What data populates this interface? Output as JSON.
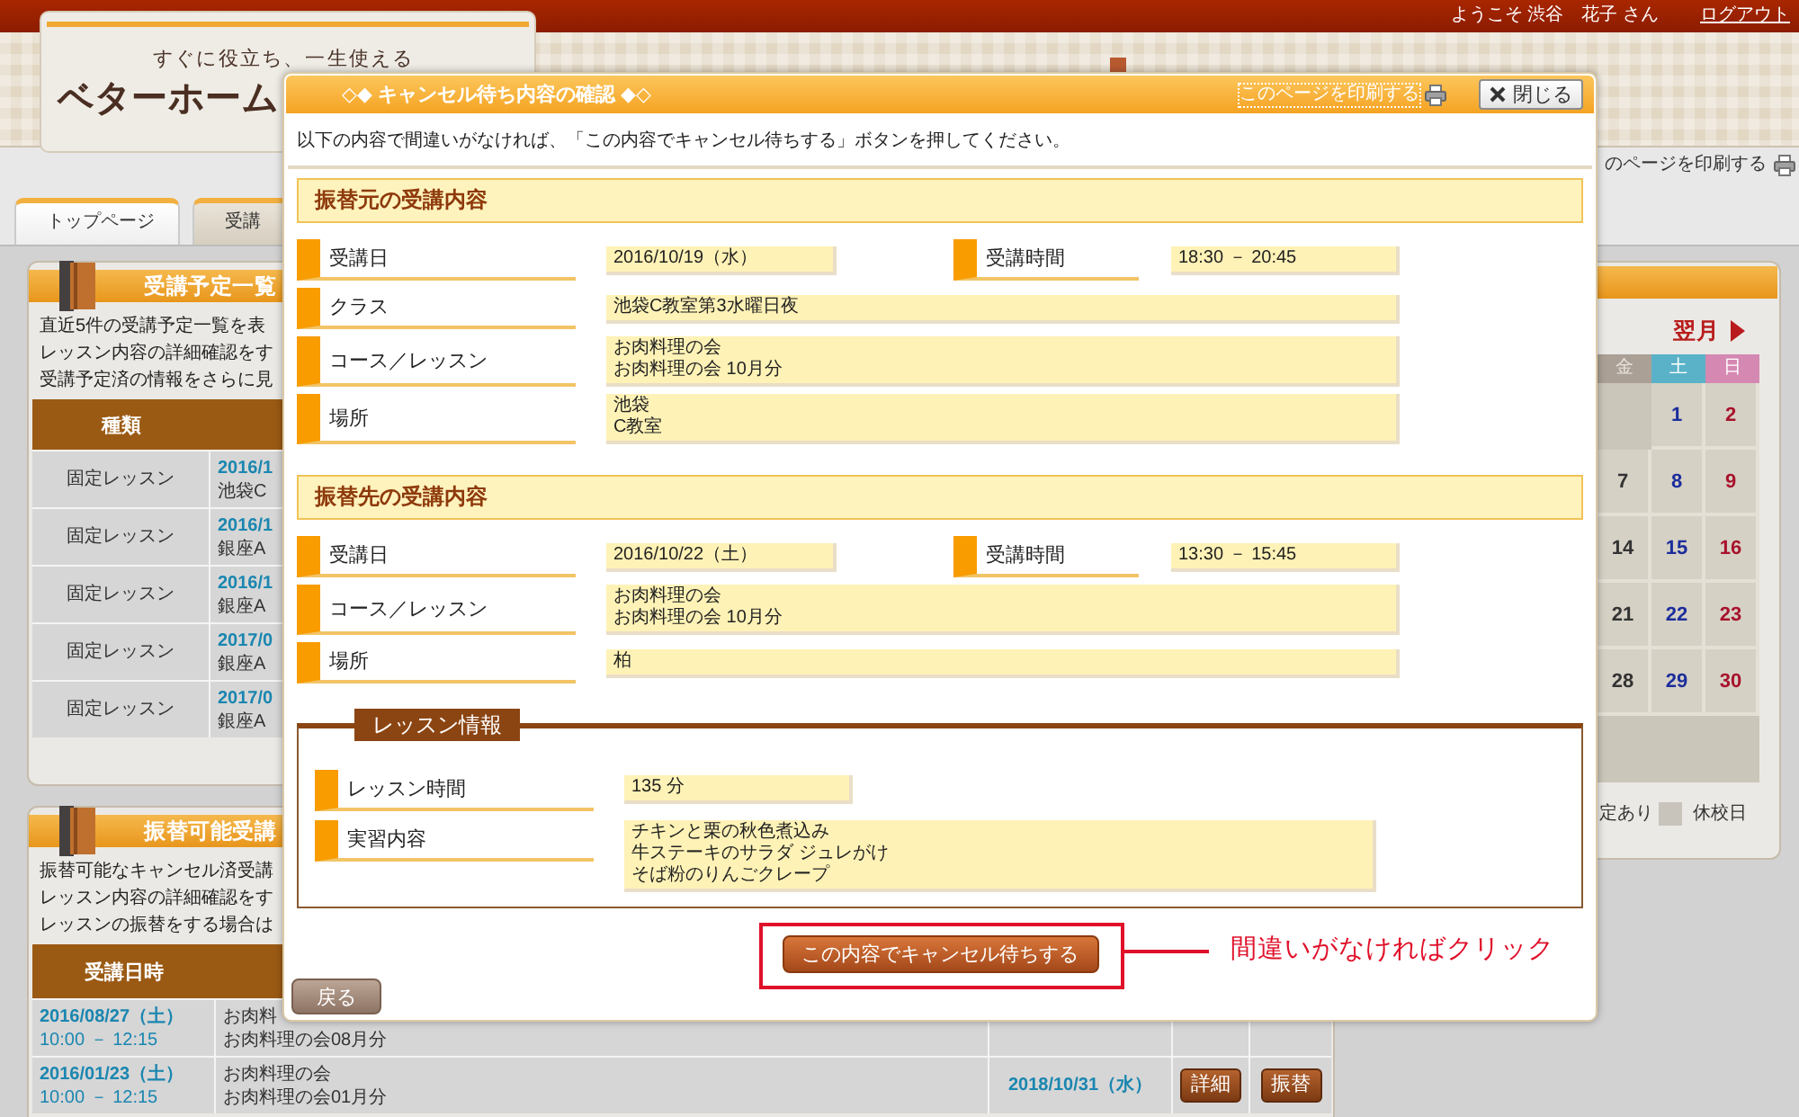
{
  "top_bar": {
    "greeting": "ようこそ 渋谷　花子 さん",
    "logout_link": "ログアウト"
  },
  "header": {
    "tagline": "すぐに役立ち、一生使える",
    "logo": "ベターホーム",
    "print_link": "のページを印刷する"
  },
  "tabs": [
    {
      "label": "トップページ",
      "selected": true
    },
    {
      "label": "受講",
      "selected": false
    }
  ],
  "schedule_panel": {
    "title": "受講予定一覧",
    "lines": [
      "直近5件の受講予定一覧を表",
      "レッスン内容の詳細確認をす",
      "受講予定済の情報をさらに見"
    ],
    "columns": [
      "種類"
    ],
    "rows": [
      {
        "type": "固定レッスン",
        "date": "2016/1",
        "place": "池袋C"
      },
      {
        "type": "固定レッスン",
        "date": "2016/1",
        "place": "銀座A"
      },
      {
        "type": "固定レッスン",
        "date": "2016/1",
        "place": "銀座A"
      },
      {
        "type": "固定レッスン",
        "date": "2017/0",
        "place": "銀座A"
      },
      {
        "type": "固定レッスン",
        "date": "2017/0",
        "place": "銀座A"
      }
    ]
  },
  "transfer_panel": {
    "title": "振替可能受講",
    "lines": [
      "振替可能なキャンセル済受講",
      "レッスン内容の詳細確認をす",
      "レッスンの振替をする場合は"
    ],
    "columns": [
      "受講日時"
    ],
    "rows": [
      {
        "date": "2016/08/27（土）",
        "time": "10:00 － 12:15",
        "course": "お肉料",
        "lesson": "お肉料理の会08月分"
      },
      {
        "date": "2016/01/23（土）",
        "time": "10:00 － 12:15",
        "course": "お肉料理の会",
        "lesson": "お肉料理の会01月分",
        "column_3": "2018/10/31（水）",
        "buttons": [
          "詳細",
          "振替"
        ]
      }
    ]
  },
  "calendar": {
    "next_link": "翌月",
    "weekdays": [
      {
        "label": "金",
        "kind": "weekday"
      },
      {
        "label": "土",
        "kind": "saturday"
      },
      {
        "label": "日",
        "kind": "sunday"
      }
    ],
    "weeks": [
      [
        {
          "kind": "blank"
        },
        {
          "kind": "day",
          "day": "1"
        },
        {
          "kind": "day",
          "day": "2"
        }
      ],
      [
        {
          "kind": "day",
          "day": "7"
        },
        {
          "kind": "day",
          "day": "8"
        },
        {
          "kind": "day",
          "day": "9"
        }
      ],
      [
        {
          "kind": "day",
          "day": "14"
        },
        {
          "kind": "day",
          "day": "15"
        },
        {
          "kind": "day",
          "day": "16"
        }
      ],
      [
        {
          "kind": "day",
          "day": "21"
        },
        {
          "kind": "day",
          "day": "22"
        },
        {
          "kind": "day",
          "day": "23"
        }
      ],
      [
        {
          "kind": "day",
          "day": "28"
        },
        {
          "kind": "day",
          "day": "29"
        },
        {
          "kind": "day",
          "day": "30"
        }
      ],
      [
        {
          "kind": "blank"
        },
        {
          "kind": "blank"
        },
        {
          "kind": "blank"
        }
      ]
    ],
    "legend": [
      {
        "label": "定あり"
      },
      {
        "label": "休校日",
        "color": "#c8c4bc"
      }
    ]
  },
  "dialog": {
    "title": "◇◆ キャンセル待ち内容の確認 ◆◇",
    "print_link": "このページを印刷する",
    "close_button": "閉じる",
    "instruction": "以下の内容で間違いがなければ、「この内容でキャンセル待ちする」ボタンを押してください。",
    "sections": [
      {
        "title": "振替元の受講内容",
        "rows": [
          [
            {
              "label": "受講日",
              "value": [
                "2016/10/19（水）"
              ]
            },
            {
              "label": "受講時間",
              "value": [
                "18:30 － 20:45"
              ]
            }
          ],
          [
            {
              "label": "クラス",
              "value": [
                "池袋C教室第3水曜日夜"
              ]
            }
          ],
          [
            {
              "label": "コース／レッスン",
              "value": [
                "お肉料理の会",
                "お肉料理の会 10月分"
              ]
            }
          ],
          [
            {
              "label": "場所",
              "value": [
                "池袋",
                "C教室"
              ]
            }
          ]
        ]
      },
      {
        "title": "振替先の受講内容",
        "rows": [
          [
            {
              "label": "受講日",
              "value": [
                "2016/10/22（土）"
              ]
            },
            {
              "label": "受講時間",
              "value": [
                "13:30 － 15:45"
              ]
            }
          ],
          [
            {
              "label": "コース／レッスン",
              "value": [
                "お肉料理の会",
                "お肉料理の会 10月分"
              ]
            }
          ],
          [
            {
              "label": "場所",
              "value": [
                "柏"
              ]
            }
          ]
        ]
      }
    ],
    "lesson_info": {
      "title": "レッスン情報",
      "rows": [
        {
          "label": "レッスン時間",
          "kind": "short",
          "value": [
            "135 分"
          ]
        },
        {
          "label": "実習内容",
          "kind": "long",
          "value": [
            "チキンと栗の秋色煮込み",
            "牛ステーキのサラダ ジュレがけ",
            "そば粉のりんごクレープ"
          ]
        }
      ]
    },
    "confirm_button": "この内容でキャンセル待ちする",
    "back_button": "戻る"
  },
  "annotation": {
    "text": "間違いがなければクリック"
  }
}
